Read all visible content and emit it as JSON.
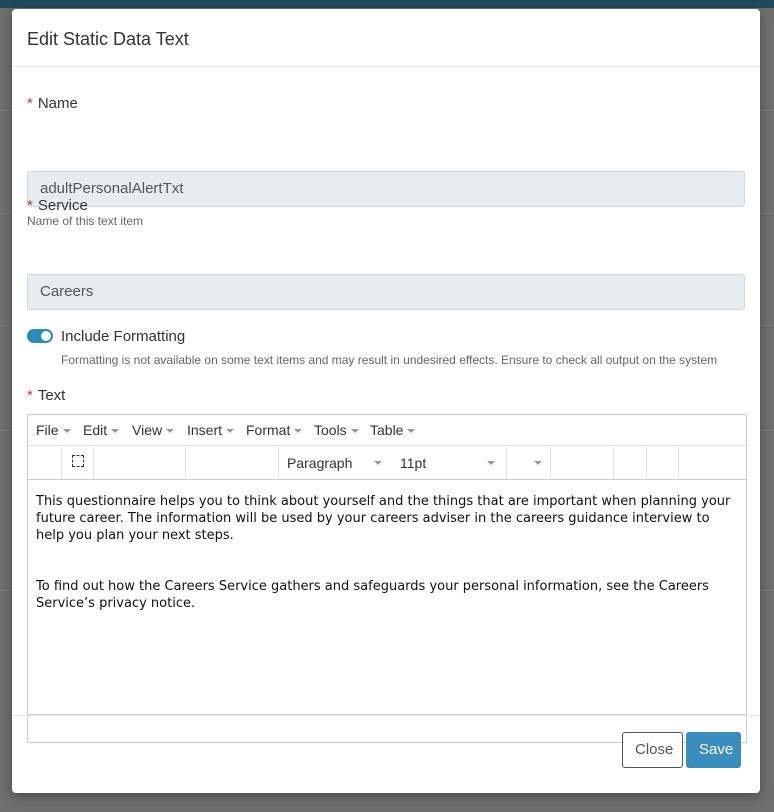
{
  "dialog": {
    "title": "Edit Static Data Text"
  },
  "form": {
    "required_marker": "*",
    "name": {
      "label": "Name",
      "value": "adultPersonalAlertTxt",
      "help": "Name of this text item"
    },
    "service": {
      "label": "Service",
      "value": "Careers"
    },
    "formatting": {
      "label": "Include Formatting",
      "enabled": true,
      "help": "Formatting is not available on some text items and may result in undesired effects. Ensure to check all output on the system"
    },
    "text": {
      "label": "Text"
    }
  },
  "editor": {
    "menu": [
      "File",
      "Edit",
      "View",
      "Insert",
      "Format",
      "Tools",
      "Table"
    ],
    "toolbar": {
      "block_format": "Paragraph",
      "font_size": "11pt",
      "icon": "select-all-icon"
    },
    "content": [
      "This questionnaire helps you to think about yourself and the things that are important when planning your future career. The information will be used by your careers adviser in the careers guidance interview to help you plan your next steps.",
      "To find out how the Careers Service gathers and safeguards your personal information, see the Careers Service’s privacy notice."
    ]
  },
  "footer": {
    "close_label": "Close",
    "save_label": "Save"
  },
  "colors": {
    "accent": "#3a8ebd",
    "required": "#c0392b",
    "toggle_on": "#2e8bb8"
  }
}
